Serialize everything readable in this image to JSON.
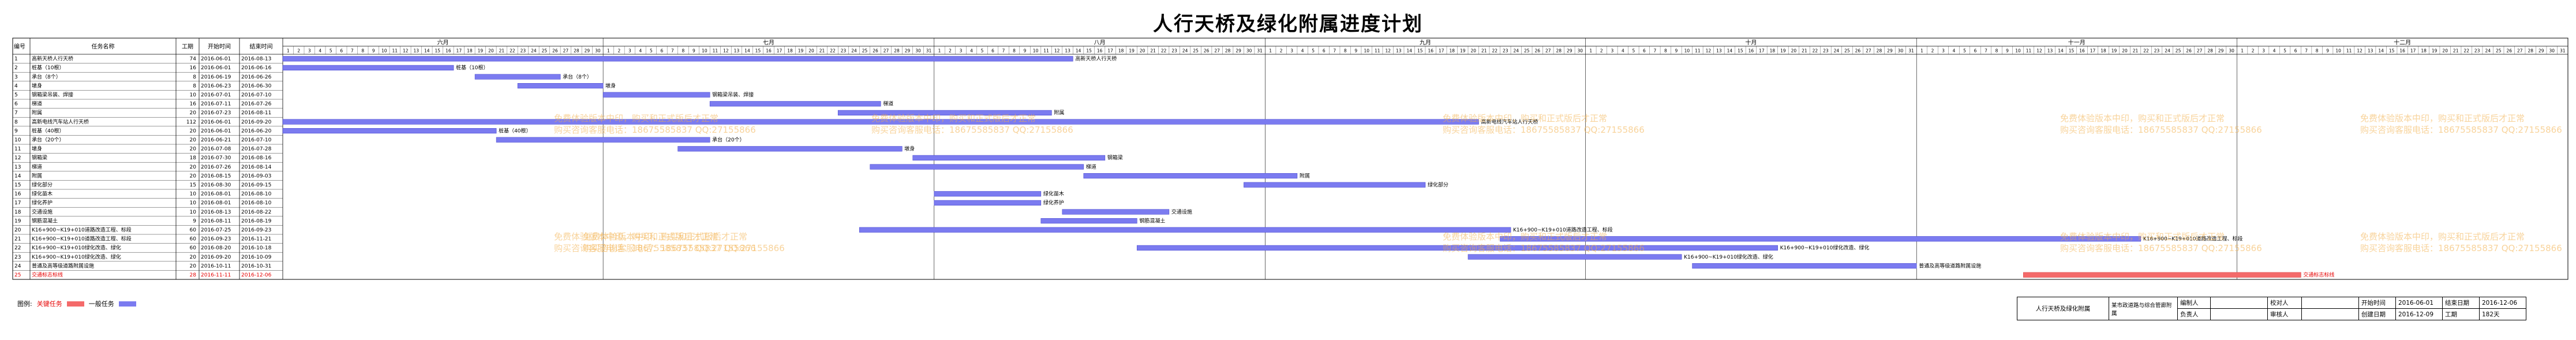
{
  "title": "人行天桥及绿化附属进度计划",
  "headers": {
    "no": "编号",
    "name": "任务名称",
    "duration": "工期",
    "start": "开始时间",
    "end": "结束时间"
  },
  "months": [
    "六月",
    "七月",
    "八月",
    "九月",
    "十月",
    "十一月",
    "十二月"
  ],
  "colors": {
    "normal_bar": "#7b7bf0",
    "critical_bar": "#f46a6a",
    "critical_text": "#e60000",
    "watermark": "#f3b04a",
    "grid": "#000000"
  },
  "watermarks": [
    "免费体验版本中印，购买和正式版后才正常",
    "购买咨询客服电话：18675585837 QQ:27155866"
  ],
  "legend": {
    "label": "图例:",
    "critical": "关键任务",
    "normal": "一般任务"
  },
  "sign_table": {
    "project": "人行天桥及绿化附属",
    "company": "某市政道路与综合管廊附属",
    "labels": {
      "edit": "编制人",
      "check": "校对人",
      "start": "开始时间",
      "end": "结束日期",
      "responsible": "负责人",
      "review": "审核人",
      "created": "创建日期",
      "duration": "工期"
    },
    "values": {
      "start": "2016-06-01",
      "end": "2016-12-06",
      "created": "2016-12-09",
      "duration": "182天"
    }
  },
  "chart_data": {
    "type": "gantt",
    "date_range": [
      "2016-06-01",
      "2016-12-31"
    ],
    "tasks": [
      {
        "id": "1",
        "name": "高新天桥人行天桥",
        "duration": "74",
        "start": "2016-06-01",
        "end": "2016-08-13",
        "label": "高新天桥人行天桥",
        "critical": false
      },
      {
        "id": "2",
        "name": "桩基（10根）",
        "duration": "16",
        "start": "2016-06-01",
        "end": "2016-06-16",
        "label": "桩基（10根）",
        "critical": false
      },
      {
        "id": "3",
        "name": "承台（8个）",
        "duration": "8",
        "start": "2016-06-19",
        "end": "2016-06-26",
        "label": "承台（8个）",
        "critical": false
      },
      {
        "id": "4",
        "name": "墩身",
        "duration": "8",
        "start": "2016-06-23",
        "end": "2016-06-30",
        "label": "墩身",
        "critical": false
      },
      {
        "id": "5",
        "name": "钢箱梁吊装、焊接",
        "duration": "10",
        "start": "2016-07-01",
        "end": "2016-07-10",
        "label": "钢箱梁吊装、焊接",
        "critical": false
      },
      {
        "id": "6",
        "name": "梯道",
        "duration": "16",
        "start": "2016-07-11",
        "end": "2016-07-26",
        "label": "梯道",
        "critical": false
      },
      {
        "id": "7",
        "name": "附属",
        "duration": "20",
        "start": "2016-07-23",
        "end": "2016-08-11",
        "label": "附属",
        "critical": false
      },
      {
        "id": "8",
        "name": "高新电线汽车站人行天桥",
        "duration": "112",
        "start": "2016-06-01",
        "end": "2016-09-20",
        "label": "高新电线汽车站人行天桥",
        "critical": false
      },
      {
        "id": "9",
        "name": "桩基（40根）",
        "duration": "20",
        "start": "2016-06-01",
        "end": "2016-06-20",
        "label": "桩基（40根）",
        "critical": false
      },
      {
        "id": "10",
        "name": "承台（20个）",
        "duration": "20",
        "start": "2016-06-21",
        "end": "2016-07-10",
        "label": "承台（20个）",
        "critical": false
      },
      {
        "id": "11",
        "name": "墩身",
        "duration": "20",
        "start": "2016-07-08",
        "end": "2016-07-28",
        "label": "墩身",
        "critical": false
      },
      {
        "id": "12",
        "name": "钢箱梁",
        "duration": "18",
        "start": "2016-07-30",
        "end": "2016-08-16",
        "label": "钢箱梁",
        "critical": false
      },
      {
        "id": "13",
        "name": "梯道",
        "duration": "20",
        "start": "2016-07-26",
        "end": "2016-08-14",
        "label": "梯道",
        "critical": false
      },
      {
        "id": "14",
        "name": "附属",
        "duration": "20",
        "start": "2016-08-15",
        "end": "2016-09-03",
        "label": "附属",
        "critical": false
      },
      {
        "id": "15",
        "name": "绿化部分",
        "duration": "15",
        "start": "2016-08-30",
        "end": "2016-09-15",
        "label": "绿化部分",
        "critical": false
      },
      {
        "id": "16",
        "name": "绿化苗木",
        "duration": "10",
        "start": "2016-08-01",
        "end": "2016-08-10",
        "label": "绿化苗木",
        "critical": false
      },
      {
        "id": "17",
        "name": "绿化养护",
        "duration": "10",
        "start": "2016-08-01",
        "end": "2016-08-10",
        "label": "绿化养护",
        "critical": false
      },
      {
        "id": "18",
        "name": "交通设施",
        "duration": "10",
        "start": "2016-08-13",
        "end": "2016-08-22",
        "label": "交通设施",
        "critical": false
      },
      {
        "id": "19",
        "name": "钢筋混凝土",
        "duration": "9",
        "start": "2016-08-11",
        "end": "2016-08-19",
        "label": "钢筋混凝土",
        "critical": false
      },
      {
        "id": "20",
        "name": "K16+900~K19+010道路改造工程、标段",
        "duration": "60",
        "start": "2016-07-25",
        "end": "2016-09-23",
        "label": "K16+900~K19+010道路改造工程、标段",
        "critical": false
      },
      {
        "id": "21",
        "name": "K16+900~K19+010道路改造工程、标段",
        "duration": "60",
        "start": "2016-09-23",
        "end": "2016-11-21",
        "label": "K16+900~K19+010道路改造工程、标段",
        "critical": false
      },
      {
        "id": "22",
        "name": "K16+900~K19+010绿化改造、绿化",
        "duration": "60",
        "start": "2016-08-20",
        "end": "2016-10-18",
        "label": "K16+900~K19+010绿化改造、绿化",
        "critical": false
      },
      {
        "id": "23",
        "name": "K16+900~K19+010绿化改造、绿化",
        "duration": "20",
        "start": "2016-09-20",
        "end": "2016-10-09",
        "label": "K16+900~K19+010绿化改造、绿化",
        "critical": false
      },
      {
        "id": "24",
        "name": "普通及高等级道路附属设施",
        "duration": "20",
        "start": "2016-10-11",
        "end": "2016-10-31",
        "label": "普通及高等级道路附属设施",
        "critical": false
      },
      {
        "id": "25",
        "name": "交通标志标线",
        "duration": "28",
        "start": "2016-11-11",
        "end": "2016-12-06",
        "label": "交通标志标线",
        "critical": true
      }
    ]
  }
}
